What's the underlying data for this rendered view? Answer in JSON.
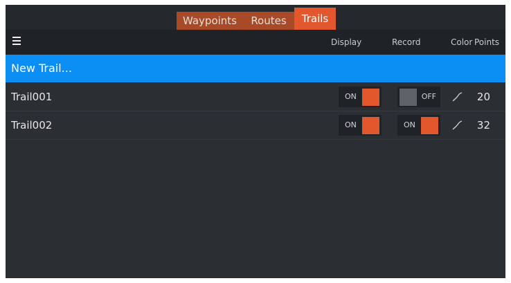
{
  "tabs": [
    {
      "label": "Waypoints",
      "active": false
    },
    {
      "label": "Routes",
      "active": false
    },
    {
      "label": "Trails",
      "active": true
    }
  ],
  "header": {
    "menu_icon": "hamburger-menu-icon",
    "columns": {
      "display": "Display",
      "record": "Record",
      "color": "Color",
      "points": "Points"
    }
  },
  "new_trail": {
    "label": "New Trail..."
  },
  "trails": [
    {
      "name": "Trail001",
      "display": {
        "state": "on",
        "label": "ON"
      },
      "record": {
        "state": "off",
        "label": "OFF"
      },
      "color_icon": "trail-line-icon",
      "points": "20"
    },
    {
      "name": "Trail002",
      "display": {
        "state": "on",
        "label": "ON"
      },
      "record": {
        "state": "on",
        "label": "ON"
      },
      "color_icon": "trail-line-icon",
      "points": "32"
    }
  ],
  "colors": {
    "accent": "#e3572c",
    "selection": "#0a8ef4",
    "toggle_off": "#5e6369",
    "background": "#2b2e33"
  }
}
